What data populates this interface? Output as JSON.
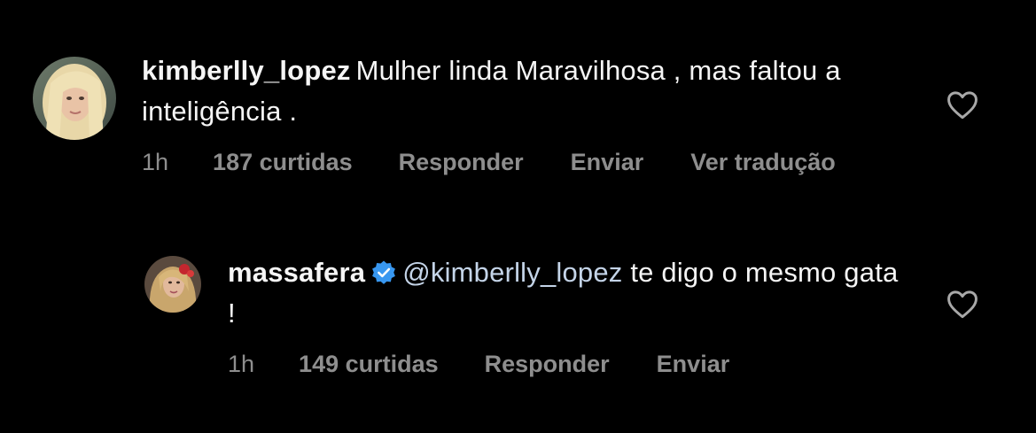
{
  "comments": [
    {
      "username": "kimberlly_lopez",
      "text": "Mulher linda Maravilhosa , mas faltou a inteligência .",
      "time": "1h",
      "likes": "187 curtidas",
      "reply_label": "Responder",
      "send_label": "Enviar",
      "translate_label": "Ver tradução",
      "verified": false,
      "avatar_icon": "avatar-blonde-woman"
    },
    {
      "username": "massafera",
      "mention": "@kimberlly_lopez",
      "text": " te digo o mesmo gata !",
      "time": "1h",
      "likes": "149 curtidas",
      "reply_label": "Responder",
      "send_label": "Enviar",
      "verified": true,
      "avatar_icon": "avatar-woman-red-flower"
    }
  ],
  "icons": {
    "like": "heart-outline-icon",
    "verified": "verified-badge-icon"
  },
  "colors": {
    "background": "#000000",
    "text": "#f5f5f5",
    "secondary": "#8e8e8e",
    "mention": "#c4d4e8",
    "verified": "#3897f0"
  }
}
